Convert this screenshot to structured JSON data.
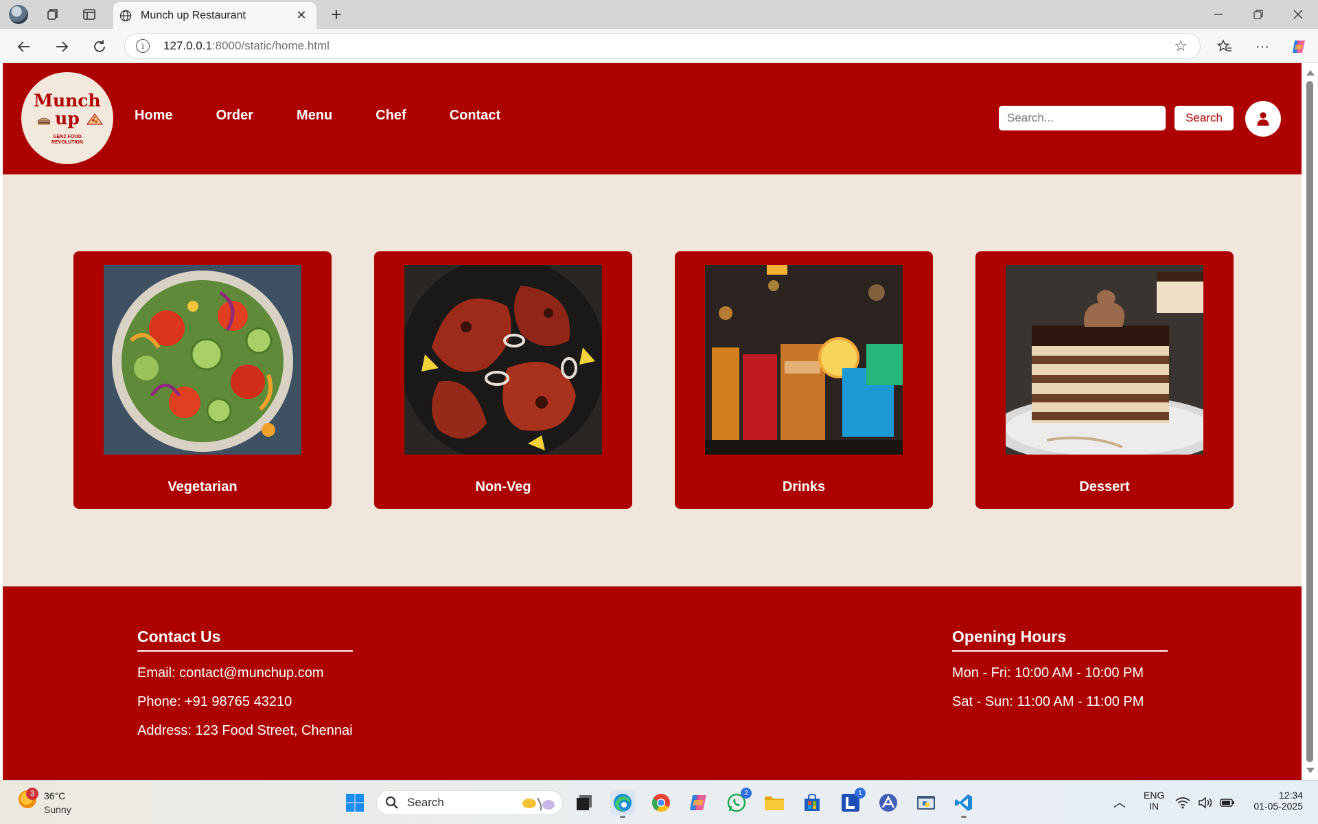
{
  "browser": {
    "tab_title": "Munch up Restaurant",
    "url_host": "127.0.0.1",
    "url_rest": ":8000/static/home.html"
  },
  "site": {
    "logo": {
      "line1": "Munch",
      "line2": "up",
      "tagline": "GENZ FOOD REVOLUTION"
    },
    "nav": [
      "Home",
      "Order",
      "Menu",
      "Chef",
      "Contact"
    ],
    "search": {
      "placeholder": "Search...",
      "button": "Search"
    },
    "categories": [
      {
        "label": "Vegetarian",
        "image": "salad-bowl"
      },
      {
        "label": "Non-Veg",
        "image": "tandoori-chicken"
      },
      {
        "label": "Drinks",
        "image": "cocktail-glasses"
      },
      {
        "label": "Dessert",
        "image": "layered-chocolate-cake"
      }
    ],
    "footer": {
      "contact": {
        "title": "Contact Us",
        "email": "Email: contact@munchup.com",
        "phone": "Phone: +91 98765 43210",
        "address": "Address: 123 Food Street, Chennai"
      },
      "hours": {
        "title": "Opening Hours",
        "weekday": "Mon - Fri: 10:00 AM - 10:00 PM",
        "weekend": "Sat - Sun: 11:00 AM - 11:00 PM"
      }
    },
    "colors": {
      "brand_red": "#ad0000",
      "page_bg": "#f0e6dc"
    }
  },
  "taskbar": {
    "weather": {
      "badge": "3",
      "temp": "36°C",
      "condition": "Sunny"
    },
    "search_label": "Search",
    "whatsapp_badge": "2",
    "l_app_badge": "1",
    "language": {
      "line1": "ENG",
      "line2": "IN"
    },
    "time": "12:34",
    "date": "01-05-2025"
  }
}
